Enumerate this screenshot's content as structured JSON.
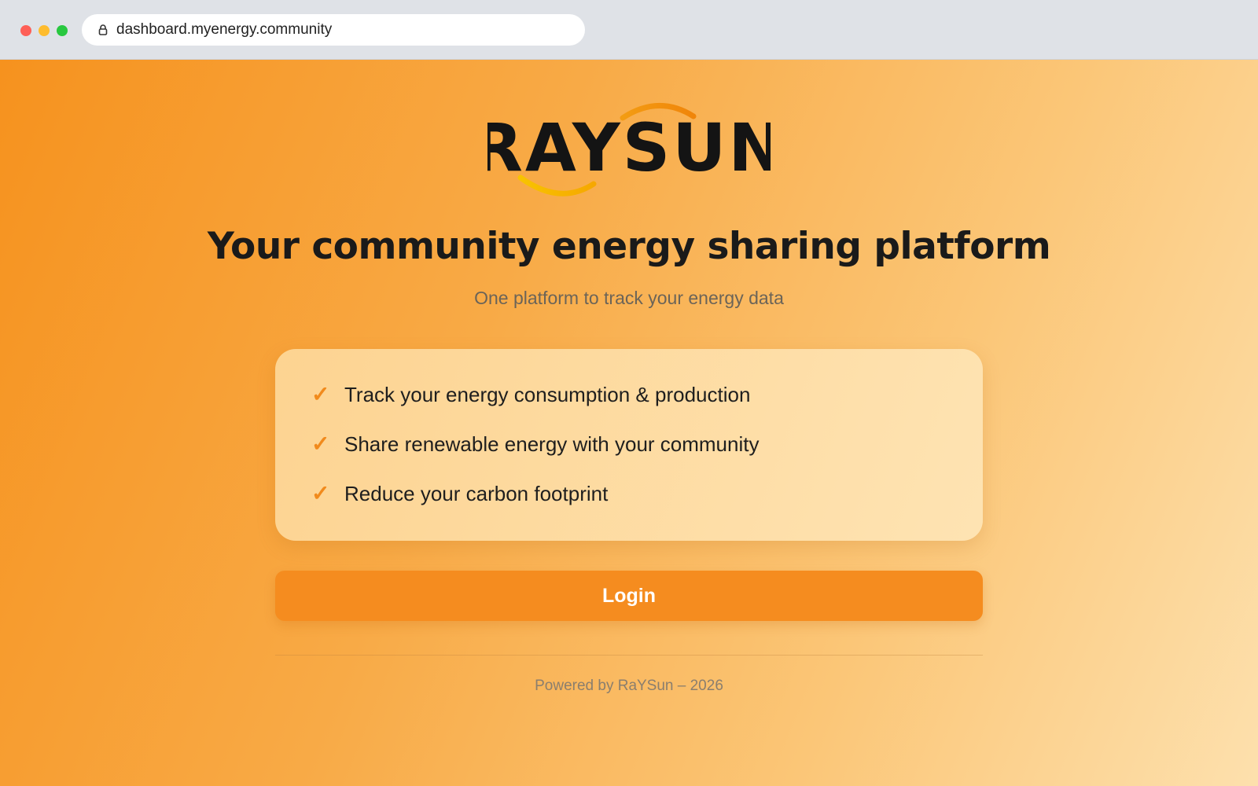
{
  "browser": {
    "url": "dashboard.myenergy.community"
  },
  "brand": {
    "logo_text": "RAYSUN",
    "accent_color": "#f58c1f",
    "arc_color": "#f5b400"
  },
  "hero": {
    "headline": "Your community energy sharing platform",
    "subheadline": "One platform to track your energy data"
  },
  "features": [
    {
      "icon": "check-icon",
      "text": "Track your energy consumption & production"
    },
    {
      "icon": "check-icon",
      "text": "Share renewable energy with your community"
    },
    {
      "icon": "check-icon",
      "text": "Reduce your carbon footprint"
    }
  ],
  "actions": {
    "login_label": "Login"
  },
  "footer": {
    "text": "Powered by RaYSun – 2026"
  }
}
